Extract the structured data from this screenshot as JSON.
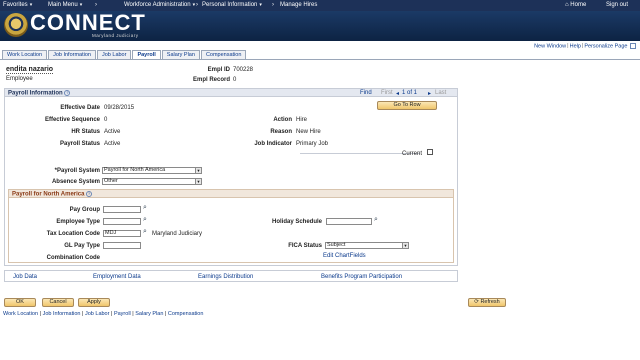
{
  "topnav": {
    "favorites": "Favorites",
    "main_menu": "Main Menu",
    "workforce_admin": "Workforce Administration",
    "personal_info": "Personal Information",
    "manage_hires": "Manage Hires",
    "home": "Home",
    "sign_out": "Sign out"
  },
  "banner": {
    "title": "CONNECT",
    "subtitle": "Maryland Judiciary"
  },
  "sublinks": {
    "new_window": "New Window",
    "help": "Help",
    "personalize": "Personalize Page"
  },
  "tabs": [
    "Work Location",
    "Job Information",
    "Job Labor",
    "Payroll",
    "Salary Plan",
    "Compensation"
  ],
  "employee": {
    "name": "endita nazario",
    "type": "Employee",
    "empl_id_label": "Empl ID",
    "empl_id": "700228",
    "empl_record_label": "Empl Record",
    "empl_record": "0"
  },
  "payroll_info": {
    "title": "Payroll Information",
    "find": "Find",
    "first": "First",
    "pager": "1 of 1",
    "last": "Last",
    "go_to_row": "Go To Row",
    "effective_date_label": "Effective Date",
    "effective_date": "09/28/2015",
    "effective_seq_label": "Effective Sequence",
    "effective_seq": "0",
    "hr_status_label": "HR Status",
    "hr_status": "Active",
    "payroll_status_label": "Payroll Status",
    "payroll_status": "Active",
    "action_label": "Action",
    "action": "Hire",
    "reason_label": "Reason",
    "reason": "New Hire",
    "job_indicator_label": "Job Indicator",
    "job_indicator": "Primary Job",
    "current_label": "Current",
    "payroll_system_label": "*Payroll System",
    "payroll_system": "Payroll for North America",
    "absence_system_label": "Absence System",
    "absence_system": "Other"
  },
  "pna": {
    "title": "Payroll for North America",
    "pay_group_label": "Pay Group",
    "pay_group": "",
    "employee_type_label": "Employee Type",
    "employee_type": "",
    "tax_location_label": "Tax Location Code",
    "tax_location": "MDJ",
    "tax_location_desc": "Maryland Judiciary",
    "gl_pay_type_label": "GL Pay Type",
    "gl_pay_type": "",
    "combination_code_label": "Combination Code",
    "holiday_schedule_label": "Holiday Schedule",
    "holiday_schedule": "",
    "fica_status_label": "FICA Status",
    "fica_status": "Subject",
    "edit_chartfields": "Edit ChartFields"
  },
  "footer_links": [
    "Job Data",
    "Employment Data",
    "Earnings Distribution",
    "Benefits Program Participation"
  ],
  "buttons": {
    "ok": "OK",
    "cancel": "Cancel",
    "apply": "Apply",
    "refresh": "Refresh"
  },
  "bottom_links": [
    "Work Location",
    "Job Information",
    "Job Labor",
    "Payroll",
    "Salary Plan",
    "Compensation"
  ]
}
